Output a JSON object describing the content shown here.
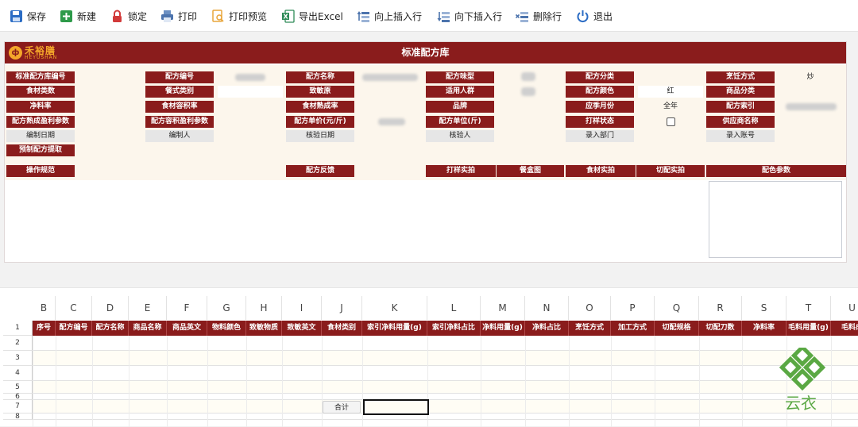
{
  "toolbar": {
    "save": "保存",
    "new": "新建",
    "lock": "锁定",
    "print": "打印",
    "print_preview": "打印预览",
    "export_excel": "导出Excel",
    "insert_above": "向上插入行",
    "insert_below": "向下插入行",
    "delete_row": "删除行",
    "exit": "退出"
  },
  "header": {
    "title": "标准配方库",
    "logo_cn": "禾裕膳",
    "logo_en": "HEYUSHAN"
  },
  "form": {
    "std_code": "标准配方库编号",
    "recipe_code": "配方编号",
    "recipe_name": "配方名称",
    "taste": "配方味型",
    "category": "配方分类",
    "cooking": "烹饪方式",
    "cooking_value": "炒",
    "food_class": "食材类数",
    "dish_type": "餐式类别",
    "allergen": "致敏原",
    "crowd": "适用人群",
    "color": "配方颜色",
    "color_value": "红",
    "goods_class": "商品分类",
    "net_rate": "净料率",
    "food_volume_rate": "食材容积率",
    "food_cook_rate": "食材熟成率",
    "brand": "品牌",
    "season": "应季月份",
    "season_value": "全年",
    "recipe_index": "配方索引",
    "cook_profit": "配方熟成盈利参数",
    "volume_profit": "配方容积盈利参数",
    "unit_price": "配方单价(元/斤)",
    "unit": "配方单位(斤)",
    "sample_status": "打样状态",
    "supplier": "供应商名称",
    "edit_date": "编制日期",
    "editor": "编制人",
    "review_date": "核验日期",
    "reviewer": "核验人",
    "dept": "录入部门",
    "account": "录入账号",
    "prefab": "预制配方提取",
    "operation_spec": "操作规范",
    "feedback": "配方反馈",
    "sample_photo": "打样实拍",
    "plate_photo": "餐盒图",
    "food_photo": "食材实拍",
    "cut_photo": "切配实拍",
    "color_params": "配色参数"
  },
  "sheet": {
    "columns": [
      "B",
      "C",
      "D",
      "E",
      "F",
      "G",
      "H",
      "I",
      "J",
      "K",
      "L",
      "M",
      "N",
      "O",
      "P",
      "Q",
      "R",
      "S",
      "T",
      "U"
    ],
    "headers": [
      "序号",
      "配方编号",
      "配方名称",
      "商品名称",
      "商品英文",
      "物料颜色",
      "致敏物质",
      "致敏英文",
      "食材类别",
      "索引净料用量(g)",
      "索引净料占比",
      "净料用量(g)",
      "净料占比",
      "烹饪方式",
      "加工方式",
      "切配规格",
      "切配刀数",
      "净料率",
      "毛料用量(g)",
      "毛料成"
    ],
    "row_numbers": [
      "1",
      "2",
      "3",
      "4",
      "5",
      "6",
      "7",
      "8"
    ],
    "sum_label": "合计"
  },
  "watermark": {
    "text": "云衣"
  },
  "colors": {
    "primary": "#8a1c1c",
    "logo": "#f4a72a",
    "watermark": "#5aa843"
  }
}
